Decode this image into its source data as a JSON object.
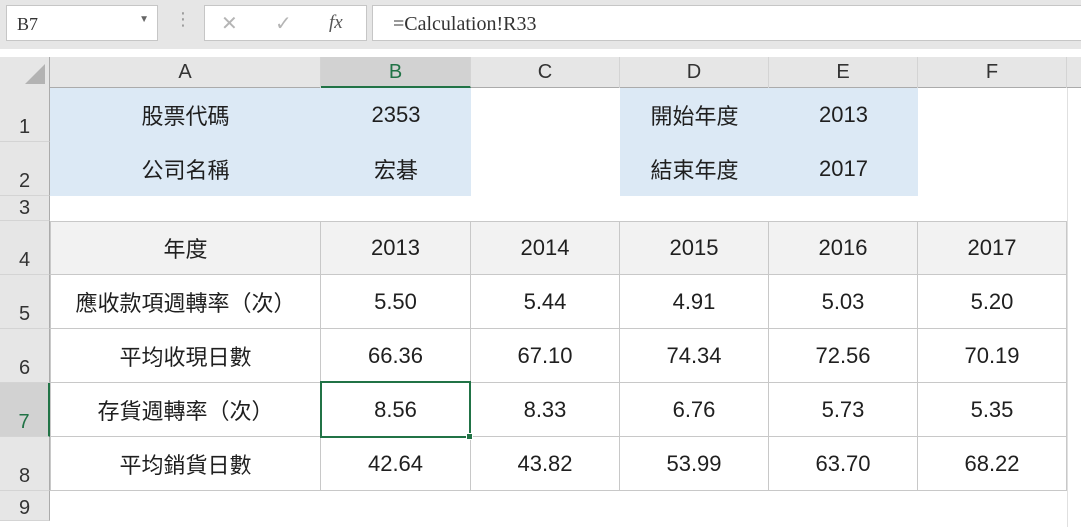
{
  "namebox": {
    "value": "B7"
  },
  "formula_bar": {
    "cancel": "✕",
    "enter": "✓",
    "fx": "fx",
    "value": "=Calculation!R33"
  },
  "columns": [
    "A",
    "B",
    "C",
    "D",
    "E",
    "F"
  ],
  "selected_column": "B",
  "rows": [
    "1",
    "2",
    "3",
    "4",
    "5",
    "6",
    "7",
    "8",
    "9"
  ],
  "selected_row": "7",
  "info": {
    "stock_code_label": "股票代碼",
    "stock_code": "2353",
    "company_label": "公司名稱",
    "company": "宏碁",
    "start_year_label": "開始年度",
    "start_year": "2013",
    "end_year_label": "結束年度",
    "end_year": "2017"
  },
  "table": {
    "header": [
      "年度",
      "2013",
      "2014",
      "2015",
      "2016",
      "2017"
    ],
    "rows": [
      [
        "應收款項週轉率（次）",
        "5.50",
        "5.44",
        "4.91",
        "5.03",
        "5.20"
      ],
      [
        "平均收現日數",
        "66.36",
        "67.10",
        "74.34",
        "72.56",
        "70.19"
      ],
      [
        "存貨週轉率（次）",
        "8.56",
        "8.33",
        "6.76",
        "5.73",
        "5.35"
      ],
      [
        "平均銷貨日數",
        "42.64",
        "43.82",
        "53.99",
        "63.70",
        "68.22"
      ]
    ]
  },
  "colors": {
    "accent": "#217346",
    "info_fill": "#dce9f5",
    "header_fill": "#f2f2f2"
  }
}
